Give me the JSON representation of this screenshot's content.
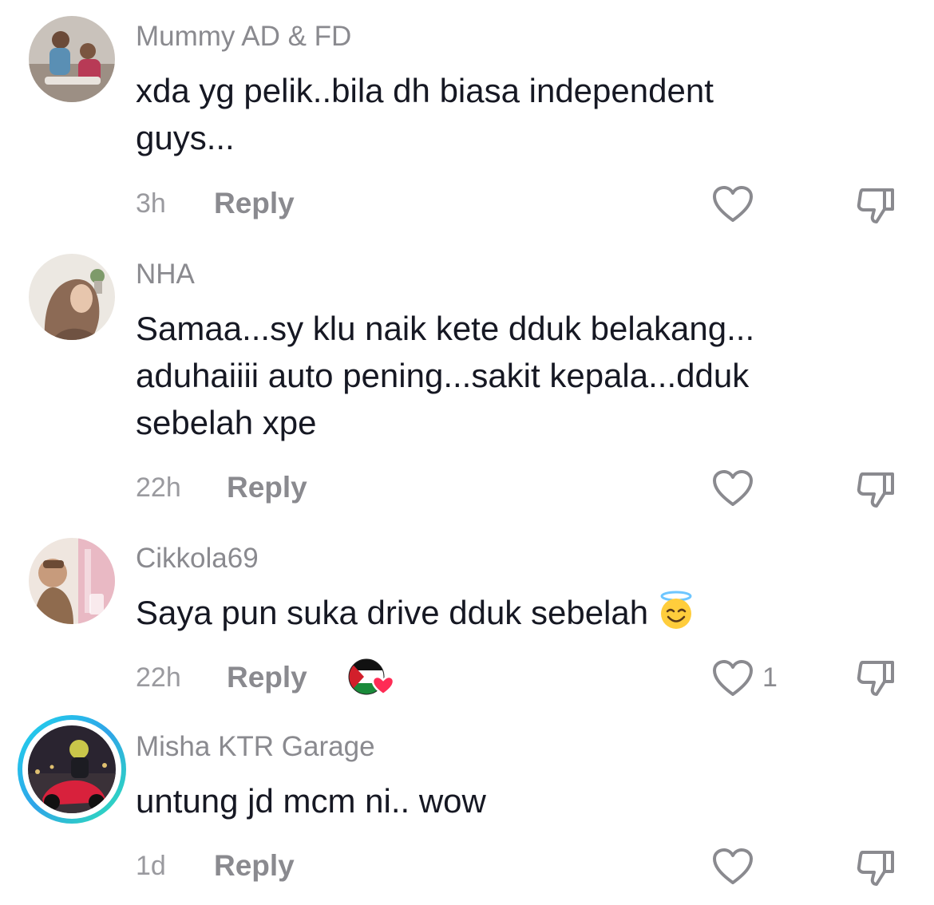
{
  "comments": [
    {
      "username": "Mummy AD & FD",
      "text_line1": "xda yg pelik..bila dh biasa independent",
      "text_line2": "guys...",
      "time": "3h",
      "reply_label": "Reply",
      "like_count": ""
    },
    {
      "username": "NHA",
      "text_line1": "Samaa...sy klu naik kete dduk belakang...",
      "text_line2": "aduhaiiii auto pening...sakit kepala...dduk",
      "text_line3": "sebelah xpe",
      "time": "22h",
      "reply_label": "Reply",
      "like_count": ""
    },
    {
      "username": "Cikkola69",
      "text_line1": "Saya pun suka drive dduk sebelah",
      "emoji": "smiling-face-with-halo",
      "time": "22h",
      "reply_label": "Reply",
      "creator_liked": true,
      "like_count": "1"
    },
    {
      "username": "Misha KTR Garage",
      "text_line1": "untung jd mcm ni.. wow",
      "time": "1d",
      "reply_label": "Reply",
      "like_count": "",
      "has_story_ring": true
    }
  ],
  "icons": {
    "like": "heart-outline-icon",
    "dislike": "thumbs-down-outline-icon"
  },
  "colors": {
    "text": "#161823",
    "muted": "#8a8a8f",
    "story_ring": "#20d5ec",
    "heart_red": "#fe2c55"
  }
}
